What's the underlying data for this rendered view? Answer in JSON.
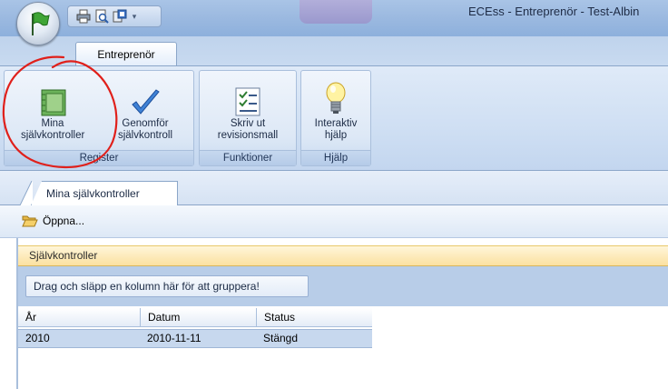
{
  "window": {
    "title": "ECEss - Entreprenör - Test-Albin"
  },
  "ribbon": {
    "tab_label": "Entreprenör",
    "groups": {
      "register": {
        "label": "Register",
        "buttons": {
          "mina": "Mina självkontroller",
          "genomfor": "Genomför självkontroll"
        }
      },
      "funktioner": {
        "label": "Funktioner",
        "buttons": {
          "skriv_ut": "Skriv ut revisionsmall"
        }
      },
      "hjalp": {
        "label": "Hjälp",
        "buttons": {
          "interaktiv": "Interaktiv hjälp"
        }
      }
    }
  },
  "document_tab": {
    "label": "Mina självkontroller"
  },
  "toolbar": {
    "open_label": "Öppna..."
  },
  "panel": {
    "title": "Självkontroller",
    "group_by_hint": "Drag och släpp en kolumn här för att gruppera!"
  },
  "grid": {
    "columns": [
      "År",
      "Datum",
      "Status"
    ],
    "rows": [
      [
        "2010",
        "2010-11-11",
        "Stängd"
      ]
    ]
  },
  "annotation": {
    "color": "#e0201b"
  }
}
